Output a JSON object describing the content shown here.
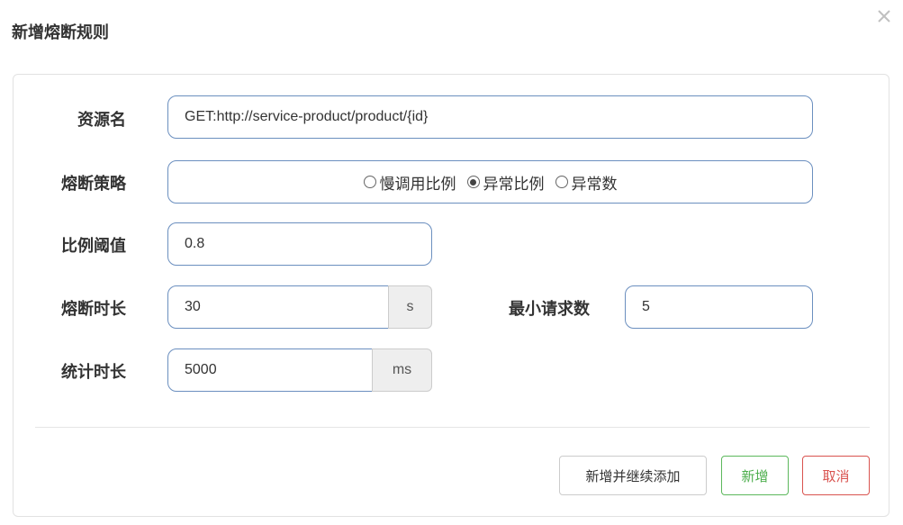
{
  "dialog": {
    "title": "新增熔断规则",
    "close_icon": "close-icon"
  },
  "form": {
    "resource": {
      "label": "资源名",
      "value": "GET:http://service-product/product/{id}"
    },
    "strategy": {
      "label": "熔断策略",
      "options": [
        "慢调用比例",
        "异常比例",
        "异常数"
      ],
      "selected": "异常比例"
    },
    "ratio": {
      "label": "比例阈值",
      "value": "0.8"
    },
    "duration": {
      "label": "熔断时长",
      "value": "30",
      "unit": "s"
    },
    "min_requests": {
      "label": "最小请求数",
      "value": "5"
    },
    "stat_interval": {
      "label": "统计时长",
      "value": "5000",
      "unit": "ms"
    }
  },
  "buttons": {
    "add_continue": "新增并继续添加",
    "add": "新增",
    "cancel": "取消"
  },
  "colors": {
    "field_border": "#6b8fbf",
    "add_green": "#5cb85c",
    "cancel_red": "#d9534f"
  }
}
